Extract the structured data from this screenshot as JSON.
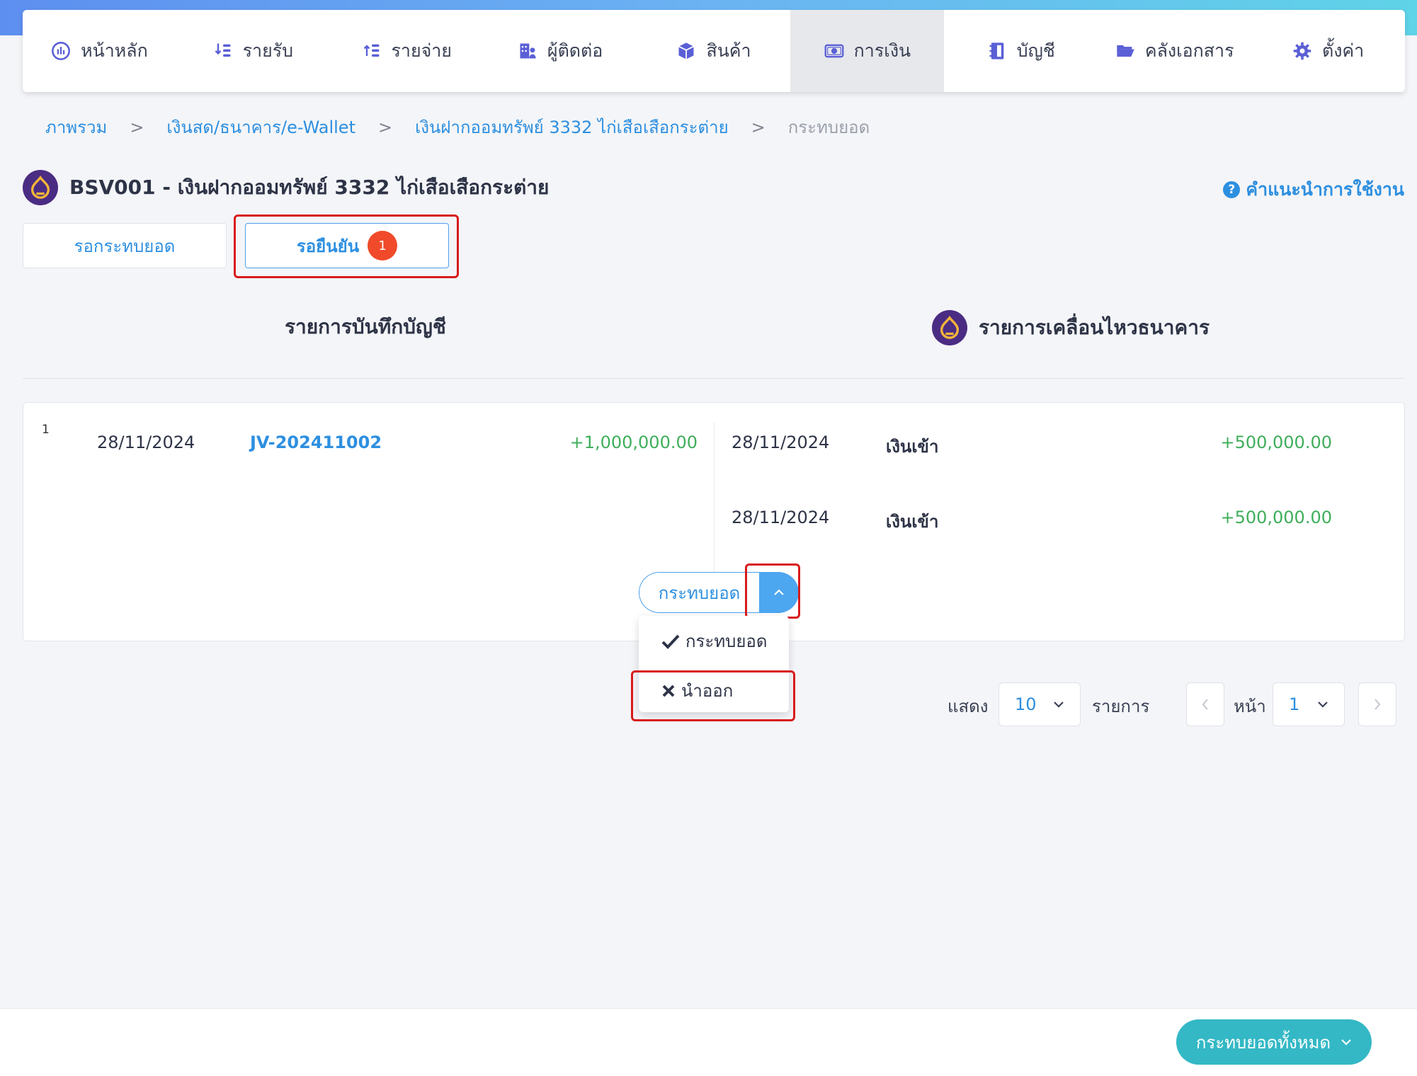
{
  "nav": {
    "items": [
      {
        "label": "หน้าหลัก",
        "icon": "dashboard-icon"
      },
      {
        "label": "รายรับ",
        "icon": "income-icon"
      },
      {
        "label": "รายจ่าย",
        "icon": "expense-icon"
      },
      {
        "label": "ผู้ติดต่อ",
        "icon": "contacts-icon"
      },
      {
        "label": "สินค้า",
        "icon": "box-icon"
      },
      {
        "label": "การเงิน",
        "icon": "money-icon"
      },
      {
        "label": "บัญชี",
        "icon": "ledger-icon"
      },
      {
        "label": "คลังเอกสาร",
        "icon": "folder-icon"
      },
      {
        "label": "ตั้งค่า",
        "icon": "gear-icon"
      }
    ],
    "active_index": 5
  },
  "breadcrumb": {
    "items": [
      "ภาพรวม",
      "เงินสด/ธนาคาร/e-Wallet",
      "เงินฝากออมทรัพย์ 3332 ไก่เสือเสือกระต่าย",
      "กระทบยอด"
    ],
    "separator": ">"
  },
  "account": {
    "title": "BSV001 - เงินฝากออมทรัพย์ 3332 ไก่เสือเสือกระต่าย",
    "help_label": "คำแนะนำการใช้งาน",
    "logo_color": "#4b2c83"
  },
  "tabs": {
    "pending_label": "รอกระทบยอด",
    "confirm_label": "รอยืนยัน",
    "confirm_count": "1"
  },
  "columns": {
    "ledger_title": "รายการบันทึกบัญชี",
    "bank_title": "รายการเคลื่อนไหวธนาคาร"
  },
  "entry": {
    "index": "1",
    "ledger": {
      "date": "28/11/2024",
      "doc_no": "JV-202411002",
      "amount": "+1,000,000.00"
    },
    "bank": [
      {
        "date": "28/11/2024",
        "desc": "เงินเข้า",
        "amount": "+500,000.00"
      },
      {
        "date": "28/11/2024",
        "desc": "เงินเข้า",
        "amount": "+500,000.00"
      }
    ]
  },
  "action": {
    "main_label": "กระทบยอด",
    "menu": [
      {
        "icon": "check-icon",
        "label": "กระทบยอด"
      },
      {
        "icon": "x-icon",
        "label": "นำออก"
      }
    ]
  },
  "pagination": {
    "show_label": "แสดง",
    "page_size": "10",
    "items_label": "รายการ",
    "page_label": "หน้า",
    "page": "1"
  },
  "footer": {
    "reconcile_all_label": "กระทบยอดทั้งหมด"
  },
  "colors": {
    "accent": "#2d8fe0",
    "positive": "#3fae5b",
    "badge": "#f04a2a",
    "footer_button": "#34b8c5"
  }
}
